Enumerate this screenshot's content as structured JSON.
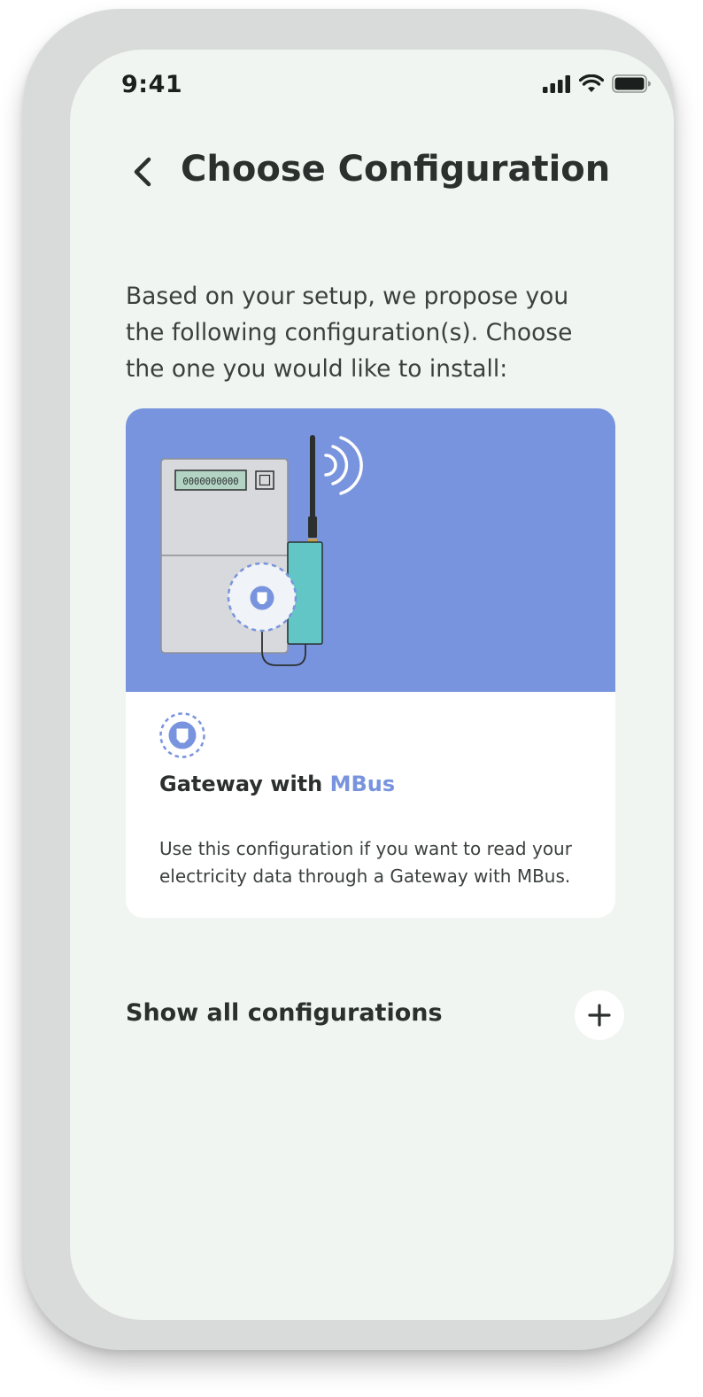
{
  "status_bar": {
    "time": "9:41"
  },
  "header": {
    "back_icon": "chevron-left-icon",
    "title": "Choose Configuration"
  },
  "intro_text": "Based on your setup, we propose you the following configuration(s). Choose the one you would like to install:",
  "configuration_card": {
    "meter_display": "0000000000",
    "title_prefix": "Gateway with",
    "title_accent": "MBus",
    "description": "Use this configuration if you want to read your electricity data through a Gateway with MBus.",
    "icon": "mbus-port-icon"
  },
  "show_all": {
    "label": "Show all configurations",
    "icon": "plus-icon"
  },
  "colors": {
    "background": "#f0f5f1",
    "card_image_bg": "#7994de",
    "accent": "#7994de",
    "gateway": "#63c6c6",
    "text": "#2b302e"
  }
}
